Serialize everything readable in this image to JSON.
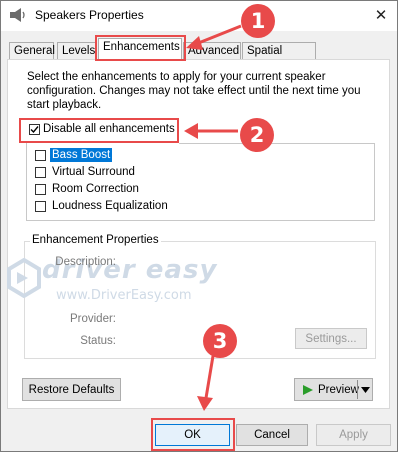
{
  "window": {
    "title": "Speakers Properties",
    "close_symbol": "✕"
  },
  "tabs": [
    {
      "label": "General"
    },
    {
      "label": "Levels"
    },
    {
      "label": "Enhancements"
    },
    {
      "label": "Advanced"
    },
    {
      "label": "Spatial sound"
    }
  ],
  "active_tab": "Enhancements",
  "enhancements": {
    "description": "Select the enhancements to apply for your current speaker configuration. Changes may not take effect until the next time you start playback.",
    "disable_all": {
      "label": "Disable all enhancements",
      "checked": true
    },
    "list": [
      {
        "label": "Bass Boost",
        "checked": false,
        "selected": true
      },
      {
        "label": "Virtual Surround",
        "checked": false,
        "selected": false
      },
      {
        "label": "Room Correction",
        "checked": false,
        "selected": false
      },
      {
        "label": "Loudness Equalization",
        "checked": false,
        "selected": false
      }
    ]
  },
  "properties": {
    "group_title": "Enhancement Properties",
    "description_label": "Description:",
    "provider_label": "Provider:",
    "status_label": "Status:",
    "settings_button": "Settings..."
  },
  "buttons": {
    "restore_defaults": "Restore Defaults",
    "preview": "Preview",
    "ok": "OK",
    "cancel": "Cancel",
    "apply": "Apply"
  },
  "annotations": {
    "step1": "1",
    "step2": "2",
    "step3": "3"
  },
  "watermark": {
    "brand": "driver easy",
    "url": "www.DriverEasy.com"
  },
  "colors": {
    "annotation_red": "#e84a4a",
    "selection_blue": "#0078d7",
    "preview_green": "#2a9d2a"
  }
}
